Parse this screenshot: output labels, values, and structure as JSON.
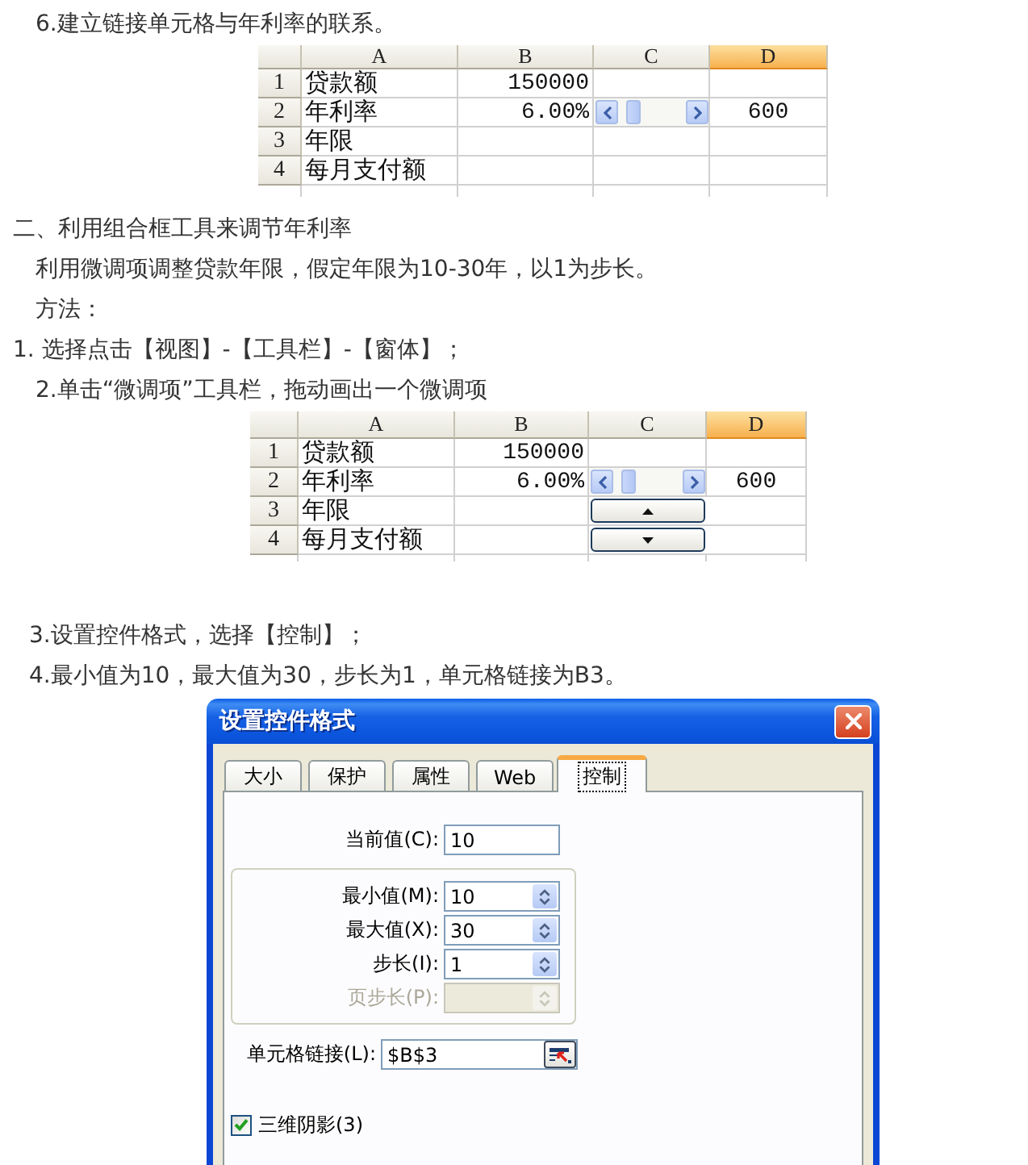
{
  "instructions_top": [
    {
      "kind": "indent",
      "text": "6.建立链接单元格与年利率的联系。"
    }
  ],
  "spreadsheet_1": {
    "columns": [
      {
        "label": "A",
        "selected": false
      },
      {
        "label": "B",
        "selected": false
      },
      {
        "label": "C",
        "selected": false
      },
      {
        "label": "D",
        "selected": true
      }
    ],
    "rows": [
      {
        "number": "1",
        "cells": [
          {
            "kind": "text",
            "text": "贷款额"
          },
          {
            "kind": "number",
            "text": "150000"
          },
          {
            "kind": "empty"
          },
          {
            "kind": "empty"
          }
        ]
      },
      {
        "number": "2",
        "cells": [
          {
            "kind": "text",
            "text": "年利率"
          },
          {
            "kind": "number",
            "text": "6.00%"
          },
          {
            "kind": "scrollbar"
          },
          {
            "kind": "result",
            "text": "600"
          }
        ]
      },
      {
        "number": "3",
        "cells": [
          {
            "kind": "text",
            "text": "年限"
          },
          {
            "kind": "empty"
          },
          {
            "kind": "empty"
          },
          {
            "kind": "empty"
          }
        ]
      },
      {
        "number": "4",
        "cells": [
          {
            "kind": "text",
            "text": "每月支付额"
          },
          {
            "kind": "empty"
          },
          {
            "kind": "empty"
          },
          {
            "kind": "empty"
          }
        ]
      }
    ]
  },
  "instructions_middle": [
    {
      "kind": "outdent",
      "text": "二、利用组合框工具来调节年利率"
    },
    {
      "kind": "indent",
      "text": "利用微调项调整贷款年限，假定年限为10-30年，以1为步长。"
    },
    {
      "kind": "indent",
      "text": "方法："
    },
    {
      "kind": "outdent",
      "text": "1. 选择点击【视图】-【工具栏】-【窗体】；"
    },
    {
      "kind": "indent",
      "text": "2.单击“微调项”工具栏，拖动画出一个微调项"
    }
  ],
  "spreadsheet_2": {
    "columns": [
      {
        "label": "A",
        "selected": false
      },
      {
        "label": "B",
        "selected": false
      },
      {
        "label": "C",
        "selected": false
      },
      {
        "label": "D",
        "selected": true
      }
    ],
    "rows": [
      {
        "number": "1",
        "cells": [
          {
            "kind": "text",
            "text": "贷款额"
          },
          {
            "kind": "number",
            "text": "150000"
          },
          {
            "kind": "empty"
          },
          {
            "kind": "empty"
          }
        ]
      },
      {
        "number": "2",
        "cells": [
          {
            "kind": "text",
            "text": "年利率"
          },
          {
            "kind": "number",
            "text": "6.00%"
          },
          {
            "kind": "scrollbar"
          },
          {
            "kind": "result",
            "text": "600"
          }
        ]
      },
      {
        "number": "3",
        "cells": [
          {
            "kind": "text",
            "text": "年限"
          },
          {
            "kind": "empty"
          },
          {
            "kind": "spinup"
          },
          {
            "kind": "empty"
          }
        ]
      },
      {
        "number": "4",
        "cells": [
          {
            "kind": "text",
            "text": "每月支付额"
          },
          {
            "kind": "empty"
          },
          {
            "kind": "spindown"
          },
          {
            "kind": "empty"
          }
        ]
      }
    ]
  },
  "instructions_bottom": [
    {
      "kind": "step",
      "text": "3.设置控件格式，选择【控制】；"
    },
    {
      "kind": "step",
      "text": "4.最小值为10，最大值为30，步长为1，单元格链接为B3。"
    }
  ],
  "dialog": {
    "title": "设置控件格式",
    "tabs": [
      {
        "label": "大小",
        "selected": false
      },
      {
        "label": "保护",
        "selected": false
      },
      {
        "label": "属性",
        "selected": false
      },
      {
        "label": "Web",
        "selected": false
      },
      {
        "label": "控制",
        "selected": true
      }
    ],
    "current_value": {
      "label": "当前值(C):",
      "value": "10"
    },
    "range_fields": [
      {
        "label": "最小值(M):",
        "value": "10",
        "disabled": false
      },
      {
        "label": "最大值(X):",
        "value": "30",
        "disabled": false
      },
      {
        "label": "步长(I):",
        "value": "1",
        "disabled": false
      },
      {
        "label": "页步长(P):",
        "disabled": true
      }
    ],
    "cell_link": {
      "label": "单元格链接(L):",
      "value": "$B$3"
    },
    "shading_checkbox": {
      "label": "三维阴影(3)",
      "checked": true
    }
  }
}
